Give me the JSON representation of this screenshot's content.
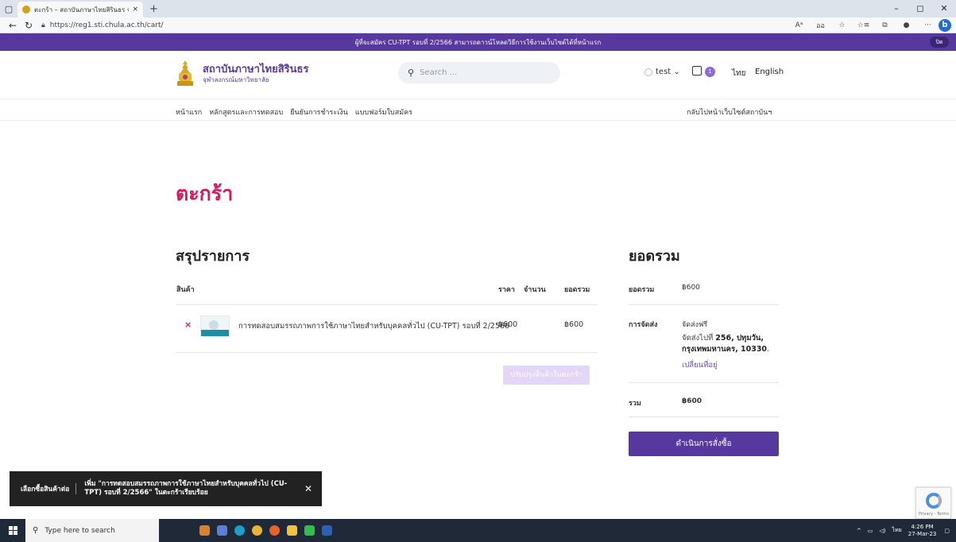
{
  "browser": {
    "tab_title": "ตะกร้า – สถาบันภาษาไทยสิรินธร จุฬาฯ",
    "tab_close": "×",
    "new_tab": "+",
    "url": "https://reg1.sti.chula.ac.th/cart/",
    "win_controls": [
      "–",
      "◻",
      "✕"
    ],
    "tools": [
      "Aᵃ",
      "ออ",
      "☆",
      "☆≡",
      "⧉",
      "●",
      "···"
    ],
    "bing": "b"
  },
  "notice": {
    "text": "ผู้ที่จะสมัคร CU-TPT รอบที่ 2/2566 สามารถดาวน์โหลดวิธีการใช้งานเว็บไซต์ได้ที่หน้าแรก",
    "close_label": "ปิด"
  },
  "header": {
    "logo_title": "สถาบันภาษาไทยสิรินธร",
    "logo_subtitle": "จุฬาลงกรณ์มหาวิทยาลัย",
    "search_placeholder": "Search ...",
    "user_name": "test",
    "cart_count": "1",
    "lang_th": "ไทย",
    "lang_en": "English"
  },
  "nav": {
    "items": [
      "หน้าแรก",
      "หลักสูตรและการทดสอบ",
      "ยืนยันการชำระเงิน",
      "แบบฟอร์มใบสมัคร"
    ],
    "back_label": "กลับไปหน้าเว็บไซต์สถาบันฯ"
  },
  "cart": {
    "title": "ตะกร้า",
    "summary_title": "สรุปรายการ",
    "headers": {
      "product": "สินค้า",
      "price": "ราคา",
      "qty": "จำนวน",
      "total": "ยอดรวม"
    },
    "items": [
      {
        "name": "การทดสอบสมรรถภาพการใช้ภาษาไทยสำหรับบุคคลทั่วไป (CU-TPT) รอบที่ 2/2566",
        "price": "฿600",
        "total": "฿600"
      }
    ],
    "update_label": "ปรับปรุงสินค้าในตะกร้า"
  },
  "totals": {
    "title": "ยอดรวม",
    "subtotal_label": "ยอดรวม",
    "subtotal_value": "฿600",
    "shipping_label": "การจัดส่ง",
    "shipping_method": "จัดส่งฟรี",
    "ship_to_prefix": "จัดส่งไปที่",
    "ship_to_bold": "256, ปทุมวัน, กรุงเทพมหานคร, 10330",
    "ship_change": "เปลี่ยนที่อยู่",
    "total_label": "รวม",
    "total_value": "฿600",
    "checkout_label": "ดำเนินการสั่งซื้อ"
  },
  "toast": {
    "action": "เลือกซื้อสินค้าต่อ",
    "message": "เพิ่ม \"การทดสอบสมรรถภาพการใช้ภาษาไทยสำหรับบุคคลทั่วไป (CU-TPT) รอบที่ 2/2566\" ในตะกร้าเรียบร้อย",
    "close": "✕"
  },
  "recaptcha": {
    "text": "Privacy - Terms"
  },
  "taskbar": {
    "search_placeholder": "Type here to search",
    "lang": "ไทย",
    "time": "4:26 PM",
    "date": "27-Mar-23"
  },
  "colors": {
    "brand_purple": "#57389e",
    "accent_pink": "#d8185e"
  }
}
